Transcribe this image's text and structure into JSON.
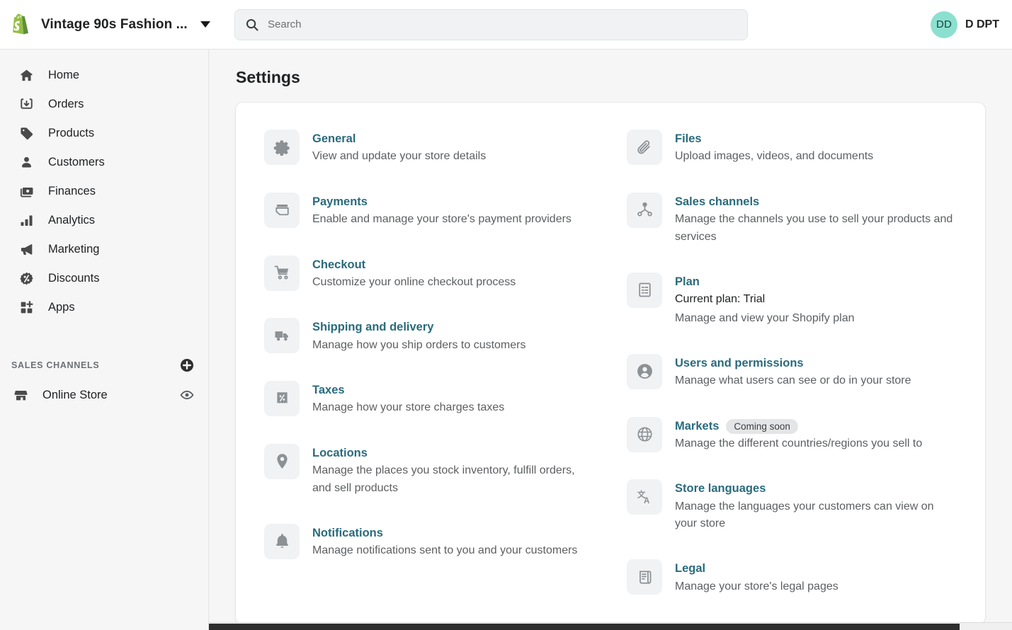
{
  "topbar": {
    "store_name": "Vintage 90s Fashion ...",
    "store_switcher_icon": "chevron-down-icon",
    "logo_icon": "shopify-logo-icon",
    "search": {
      "placeholder": "Search",
      "value": "",
      "icon": "search-icon"
    },
    "user": {
      "initials": "DD",
      "name": "D DPT",
      "avatar_color": "#8ce0d0"
    }
  },
  "sidebar": {
    "items": [
      {
        "label": "Home",
        "icon": "home-icon"
      },
      {
        "label": "Orders",
        "icon": "orders-inbox-icon"
      },
      {
        "label": "Products",
        "icon": "product-tag-icon"
      },
      {
        "label": "Customers",
        "icon": "customer-person-icon"
      },
      {
        "label": "Finances",
        "icon": "finances-cash-icon"
      },
      {
        "label": "Analytics",
        "icon": "analytics-bars-icon"
      },
      {
        "label": "Marketing",
        "icon": "marketing-megaphone-icon"
      },
      {
        "label": "Discounts",
        "icon": "discount-percent-icon"
      },
      {
        "label": "Apps",
        "icon": "apps-grid-plus-icon"
      }
    ],
    "section": {
      "title": "SALES CHANNELS",
      "add_icon": "plus-circle-icon"
    },
    "channels": [
      {
        "label": "Online Store",
        "icon": "storefront-icon",
        "action_icon": "eye-icon"
      }
    ]
  },
  "main": {
    "page_title": "Settings",
    "settings_left": [
      {
        "title": "General",
        "icon": "gear-icon",
        "desc": "View and update your store details"
      },
      {
        "title": "Payments",
        "icon": "payments-card-icon",
        "desc": "Enable and manage your store's payment providers"
      },
      {
        "title": "Checkout",
        "icon": "checkout-cart-icon",
        "desc": "Customize your online checkout process"
      },
      {
        "title": "Shipping and delivery",
        "icon": "shipping-truck-icon",
        "desc": "Manage how you ship orders to customers"
      },
      {
        "title": "Taxes",
        "icon": "taxes-receipt-percent-icon",
        "desc": "Manage how your store charges taxes"
      },
      {
        "title": "Locations",
        "icon": "location-pin-icon",
        "desc": "Manage the places you stock inventory, fulfill orders, and sell products"
      },
      {
        "title": "Notifications",
        "icon": "notifications-bell-icon",
        "desc": "Manage notifications sent to you and your customers"
      }
    ],
    "settings_right": [
      {
        "title": "Files",
        "icon": "files-paperclip-icon",
        "desc": "Upload images, videos, and documents"
      },
      {
        "title": "Sales channels",
        "icon": "sales-channels-network-icon",
        "desc": "Manage the channels you use to sell your products and services"
      },
      {
        "title": "Plan",
        "icon": "plan-clipboard-icon",
        "desc_primary": "Current plan: Trial",
        "desc": "Manage and view your Shopify plan"
      },
      {
        "title": "Users and permissions",
        "icon": "users-person-circle-icon",
        "desc": "Manage what users can see or do in your store"
      },
      {
        "title": "Markets",
        "icon": "markets-globe-icon",
        "badge": "Coming soon",
        "desc": "Manage the different countries/regions you sell to"
      },
      {
        "title": "Store languages",
        "icon": "store-languages-translate-icon",
        "desc": "Manage the languages your customers can view on your store"
      },
      {
        "title": "Legal",
        "icon": "legal-scroll-icon",
        "desc": "Manage your store's legal pages"
      }
    ]
  },
  "colors": {
    "link": "#2a6b7c",
    "page_bg": "#f6f6f7",
    "card_bg": "#ffffff",
    "icon_tile": "#f1f2f3",
    "badge_bg": "#e4e5e7"
  }
}
